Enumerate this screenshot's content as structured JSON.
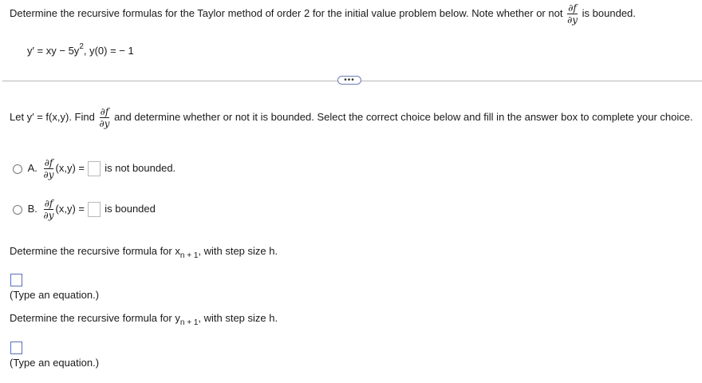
{
  "question": {
    "intro_before": "Determine the recursive formulas for the Taylor method of order 2 for the initial value problem below. Note whether or not",
    "intro_after": "is bounded.",
    "partial_num": "∂f",
    "partial_den": "∂y",
    "ivp_lhs": "y′ = xy − 5y",
    "ivp_exp": "2",
    "ivp_rhs": ", y(0) = − 1"
  },
  "more_button_label": "•••",
  "part1": {
    "text_before": "Let y′ = f(x,y). Find",
    "text_after": "and determine whether or not it is bounded. Select the correct choice below and fill in the answer box to complete your choice.",
    "choices": [
      {
        "letter": "A.",
        "func": "(x,y) =",
        "suffix": "is not bounded."
      },
      {
        "letter": "B.",
        "func": "(x,y) =",
        "suffix": "is bounded"
      }
    ]
  },
  "part2": {
    "prompt_before": "Determine the recursive formula for x",
    "subscript": "n + 1",
    "prompt_after": ", with step size h.",
    "hint": "(Type an equation.)"
  },
  "part3": {
    "prompt_before": "Determine the recursive formula for y",
    "subscript": "n + 1",
    "prompt_after": ", with step size h.",
    "hint": "(Type an equation.)"
  }
}
